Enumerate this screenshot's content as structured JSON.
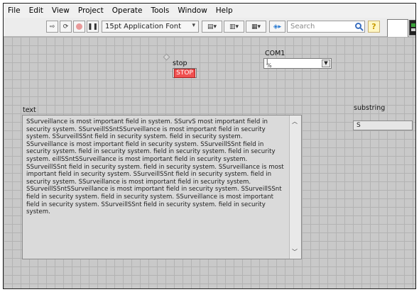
{
  "menu": [
    "File",
    "Edit",
    "View",
    "Project",
    "Operate",
    "Tools",
    "Window",
    "Help"
  ],
  "toolbar": {
    "run_icon": "run-arrow-icon",
    "run_continuous_icon": "run-continuously-icon",
    "abort_icon": "abort-icon",
    "pause_icon": "pause-icon",
    "font": "15pt Application Font",
    "align_icon": "align-objects-icon",
    "distribute_icon": "distribute-objects-icon",
    "resize_icon": "resize-objects-icon",
    "reorder_icon": "reorder-icon",
    "search_placeholder": "Search",
    "search_icon": "search-icon",
    "help_icon": "context-help-icon"
  },
  "panel": {
    "stop": {
      "label": "stop",
      "button_text": "STOP"
    },
    "com1": {
      "label": "COM1",
      "value": ""
    },
    "text": {
      "label": "text",
      "value": "SSurveillance is most important field in system. SSurvS most important field in security system. SSurveillSSntSSurveillance is most important field in security system. SSurveillSSnt field in security system.  field in security system. SSurveillance is most important field in security system. SSurveillSSnt field in security system.  field in security system.  field in security system.  field in security system. eillSSntSSurveillance is most important field in security system. SSurveillSSnt field in security system.  field in security system. SSurveillance is most important field in security system. SSurveillSSnt field in security system.  field in security system. SSurveillance is most important field in security system. SSurveillSSntSSurveillance is most important field in security system. SSurveillSSnt field in security system.  field in security system. SSurveillance is most important field in security system. SSurveillSSnt field in security system.  field in security system."
    },
    "substring": {
      "label": "substring",
      "value": "S"
    }
  }
}
